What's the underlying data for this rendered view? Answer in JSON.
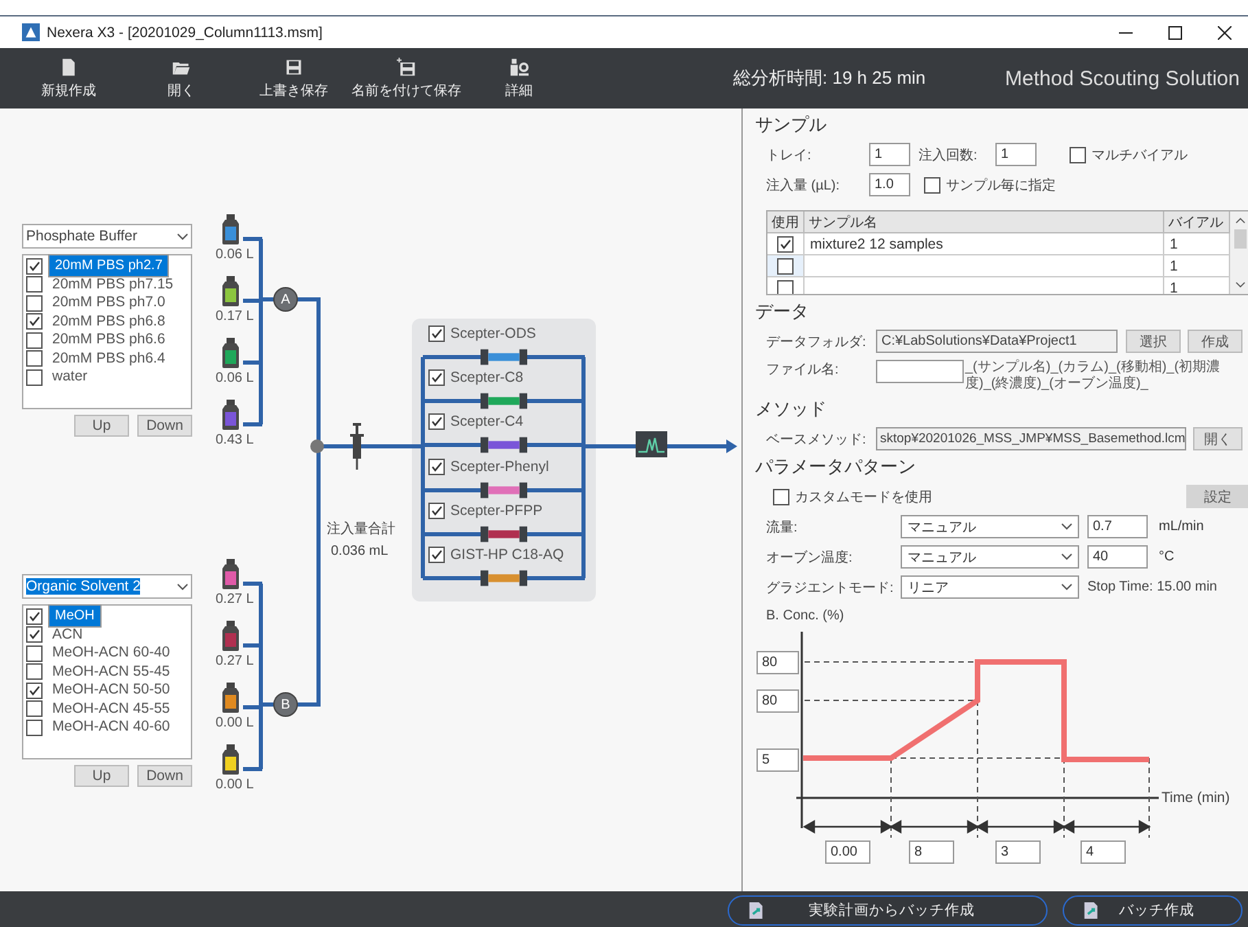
{
  "window": {
    "title": "Nexera X3 - [20201029_Column1113.msm]"
  },
  "toolbar": {
    "buttons": [
      {
        "label": "新規作成",
        "kind": "new"
      },
      {
        "label": "開く",
        "kind": "open"
      },
      {
        "label": "上書き保存",
        "kind": "save"
      },
      {
        "label": "名前を付けて保存",
        "kind": "saveas"
      },
      {
        "label": "詳細",
        "kind": "detail"
      }
    ],
    "total_time": "総分析時間: 19 h 25 min",
    "product": "Method Scouting Solution"
  },
  "solvent_groups": [
    {
      "selection": "Phosphate Buffer",
      "selection_highlighted": false,
      "pump": "A",
      "buttons": [
        "Up",
        "Down"
      ],
      "items": [
        {
          "label": "20mM PBS ph2.7",
          "checked": true,
          "selected": true
        },
        {
          "label": "20mM PBS ph7.15",
          "checked": false,
          "selected": false
        },
        {
          "label": "20mM PBS ph7.0",
          "checked": false,
          "selected": false
        },
        {
          "label": "20mM PBS ph6.8",
          "checked": true,
          "selected": false
        },
        {
          "label": "20mM PBS ph6.6",
          "checked": false,
          "selected": false
        },
        {
          "label": "20mM PBS ph6.4",
          "checked": false,
          "selected": false
        },
        {
          "label": "water",
          "checked": false,
          "selected": false
        }
      ],
      "bottles": [
        {
          "volume": "0.06 L",
          "color": "#3a8fd8"
        },
        {
          "volume": "0.17 L",
          "color": "#8cc63f"
        },
        {
          "volume": "0.06 L",
          "color": "#1fa85a"
        },
        {
          "volume": "0.43 L",
          "color": "#7a55d8"
        }
      ]
    },
    {
      "selection": "Organic Solvent 2",
      "selection_highlighted": true,
      "pump": "B",
      "buttons": [
        "Up",
        "Down"
      ],
      "items": [
        {
          "label": "MeOH",
          "checked": true,
          "selected": true
        },
        {
          "label": "ACN",
          "checked": true,
          "selected": false
        },
        {
          "label": "MeOH-ACN 60-40",
          "checked": false,
          "selected": false
        },
        {
          "label": "MeOH-ACN 55-45",
          "checked": false,
          "selected": false
        },
        {
          "label": "MeOH-ACN 50-50",
          "checked": true,
          "selected": false
        },
        {
          "label": "MeOH-ACN 45-55",
          "checked": false,
          "selected": false
        },
        {
          "label": "MeOH-ACN 40-60",
          "checked": false,
          "selected": false
        }
      ],
      "bottles": [
        {
          "volume": "0.27 L",
          "color": "#e05aa8"
        },
        {
          "volume": "0.27 L",
          "color": "#b03050"
        },
        {
          "volume": "0.00 L",
          "color": "#e08a20"
        },
        {
          "volume": "0.00 L",
          "color": "#f0d020"
        }
      ]
    }
  ],
  "mixer": {
    "label": "注入量合計",
    "value": "0.036 mL"
  },
  "columns": [
    {
      "label": "Scepter-ODS",
      "checked": true,
      "color": "#3a8fd8"
    },
    {
      "label": "Scepter-C8",
      "checked": true,
      "color": "#1fa85a"
    },
    {
      "label": "Scepter-C4",
      "checked": true,
      "color": "#7a55d8"
    },
    {
      "label": "Scepter-Phenyl",
      "checked": true,
      "color": "#e070b8"
    },
    {
      "label": "Scepter-PFPP",
      "checked": true,
      "color": "#b03050"
    },
    {
      "label": "GIST-HP C18-AQ",
      "checked": true,
      "color": "#d89030"
    }
  ],
  "sample": {
    "title": "サンプル",
    "tray_label": "トレイ:",
    "tray": "1",
    "count_label": "注入回数:",
    "count": "1",
    "multivial": {
      "label": "マルチバイアル",
      "checked": false
    },
    "volume_label": "注入量 (µL):",
    "volume": "1.0",
    "per_sample": {
      "label": "サンプル毎に指定",
      "checked": false
    },
    "table": {
      "columns": [
        "使用",
        "サンプル名",
        "バイアル"
      ],
      "rows": [
        {
          "use": true,
          "name": "mixture2 12 samples",
          "vial": "1",
          "selected": false
        },
        {
          "use": false,
          "vial": "1",
          "selected": true
        },
        {
          "use": false,
          "vial": "1",
          "selected": false
        }
      ]
    }
  },
  "data": {
    "title": "データ",
    "folder_label": "データフォルダ:",
    "folder": "C:¥LabSolutions¥Data¥Project1",
    "select": "選択",
    "create": "作成",
    "file_label": "ファイル名:",
    "file_suffix": "_(サンプル名)_(カラム)_(移動相)_(初期濃度)_(終濃度)_(オーブン温度)_"
  },
  "method": {
    "title": "メソッド",
    "base_label": "ベースメソッド:",
    "base": "sktop¥20201026_MSS_JMP¥MSS_Basemethod.lcm",
    "open": "開く"
  },
  "params": {
    "title": "パラメータパターン",
    "custom": {
      "label": "カスタムモードを使用",
      "checked": false
    },
    "settings": "設定",
    "rows": [
      {
        "label": "流量:",
        "mode": "マニュアル",
        "value": "0.7",
        "unit": "mL/min"
      },
      {
        "label": "オーブン温度:",
        "mode": "マニュアル",
        "value": "40",
        "unit": "°C"
      },
      {
        "label": "グラジエントモード:",
        "mode": "リニア",
        "note": "Stop Time: 15.00 min"
      }
    ]
  },
  "gradient": {
    "ylabel": "B. Conc. (%)",
    "xlabel": "Time (min)",
    "conc_fields": [
      "80",
      "80",
      "5"
    ],
    "time_fields": [
      "0.00",
      "8",
      "3",
      "4"
    ]
  },
  "footer": {
    "buttons": [
      "実験計画からバッチ作成",
      "バッチ作成"
    ]
  }
}
